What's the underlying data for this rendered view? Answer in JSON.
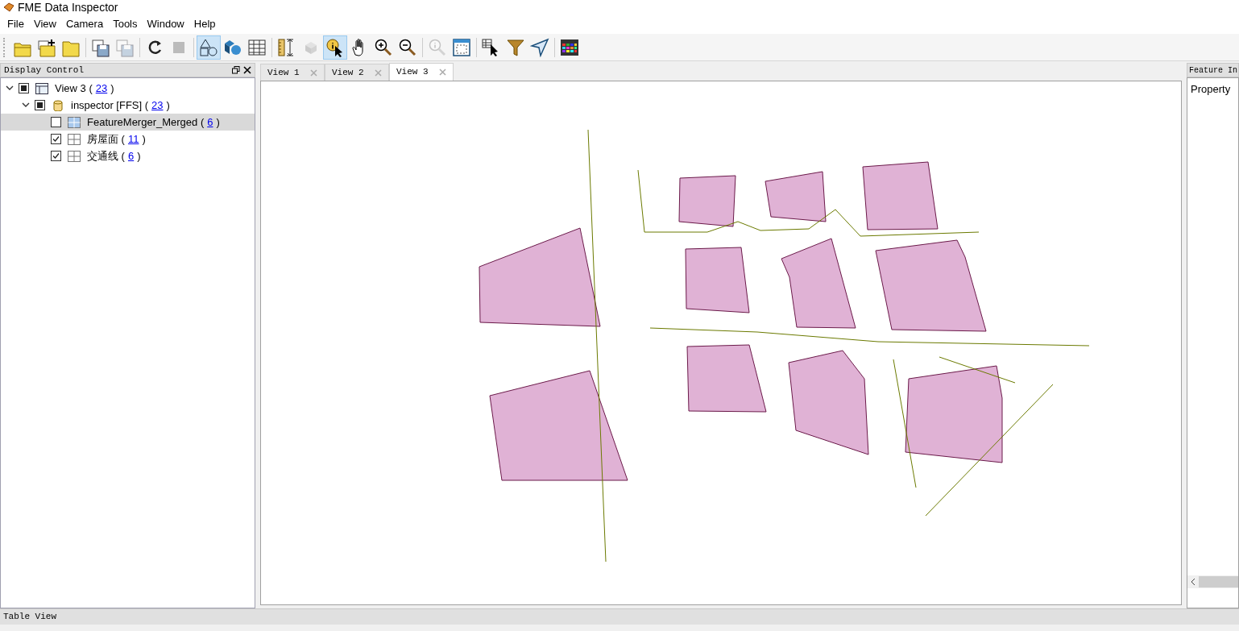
{
  "window": {
    "title": "FME Data Inspector"
  },
  "menu": [
    {
      "label": "File"
    },
    {
      "label": "View"
    },
    {
      "label": "Camera"
    },
    {
      "label": "Tools"
    },
    {
      "label": "Window"
    },
    {
      "label": "Help"
    }
  ],
  "toolbar": [
    {
      "kind": "open",
      "selected": false,
      "disabled": false
    },
    {
      "kind": "add",
      "selected": false,
      "disabled": false
    },
    {
      "kind": "folder",
      "selected": false,
      "disabled": false
    },
    {
      "kind": "separator"
    },
    {
      "kind": "save",
      "selected": false,
      "disabled": false
    },
    {
      "kind": "save",
      "selected": false,
      "disabled": true
    },
    {
      "kind": "separator"
    },
    {
      "kind": "refresh",
      "selected": false,
      "disabled": false
    },
    {
      "kind": "stop",
      "selected": false,
      "disabled": true
    },
    {
      "kind": "separator"
    },
    {
      "kind": "shapes",
      "selected": true,
      "disabled": false
    },
    {
      "kind": "solids",
      "selected": false,
      "disabled": false
    },
    {
      "kind": "table",
      "selected": false,
      "disabled": false
    },
    {
      "kind": "separator"
    },
    {
      "kind": "ruler",
      "selected": false,
      "disabled": false
    },
    {
      "kind": "cube",
      "selected": false,
      "disabled": true
    },
    {
      "kind": "info",
      "selected": true,
      "disabled": false
    },
    {
      "kind": "hand",
      "selected": false,
      "disabled": false
    },
    {
      "kind": "zoomin",
      "selected": false,
      "disabled": false
    },
    {
      "kind": "zoomout",
      "selected": false,
      "disabled": false
    },
    {
      "kind": "separator"
    },
    {
      "kind": "magnify",
      "selected": false,
      "disabled": true
    },
    {
      "kind": "extent",
      "selected": false,
      "disabled": false
    },
    {
      "kind": "separator"
    },
    {
      "kind": "tablepick",
      "selected": false,
      "disabled": false
    },
    {
      "kind": "filter",
      "selected": false,
      "disabled": false
    },
    {
      "kind": "send",
      "selected": false,
      "disabled": false
    },
    {
      "kind": "separator"
    },
    {
      "kind": "grid",
      "selected": false,
      "disabled": false
    }
  ],
  "display_control": {
    "title": "Display Control",
    "tree": [
      {
        "kind": "view",
        "before": "View 3 (",
        "count": "23",
        "after": ")",
        "checked": true,
        "mixed": true,
        "expanded": true,
        "selected": false,
        "children": [
          {
            "kind": "database",
            "before": "inspector [FFS] (",
            "count": "23",
            "after": ")",
            "checked": true,
            "mixed": true,
            "expanded": true,
            "selected": false,
            "children": [
              {
                "kind": "layer",
                "before": "FeatureMerger_Merged (",
                "count": "6",
                "after": ")",
                "checked": false,
                "mixed": false,
                "selected": true
              },
              {
                "kind": "layer",
                "before": "房屋面 (",
                "count": "11",
                "after": ")",
                "checked": true,
                "mixed": false,
                "selected": false
              },
              {
                "kind": "layer",
                "before": "交通线 (",
                "count": "6",
                "after": ")",
                "checked": true,
                "mixed": false,
                "selected": false
              }
            ]
          }
        ]
      }
    ]
  },
  "tabs": [
    {
      "label": "View 1",
      "selected": false
    },
    {
      "label": "View 2",
      "selected": false
    },
    {
      "label": "View 3",
      "selected": true
    }
  ],
  "feature_info": {
    "title": "Feature In",
    "column": "Property"
  },
  "status_bar": {
    "label": "Table View"
  }
}
